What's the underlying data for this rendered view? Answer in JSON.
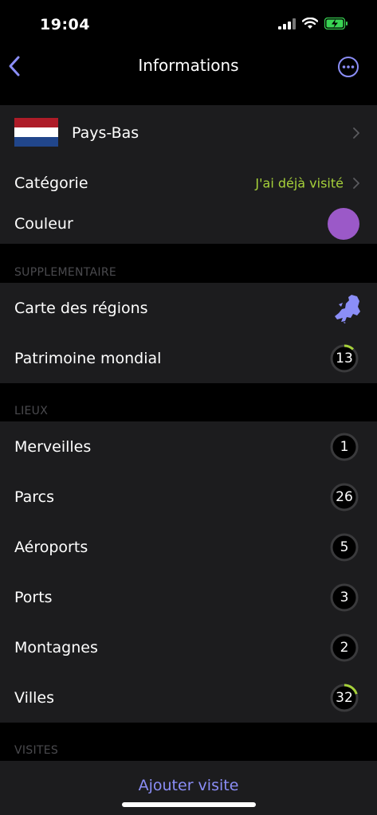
{
  "status": {
    "time": "19:04"
  },
  "nav": {
    "title": "Informations"
  },
  "country": {
    "name": "Pays-Bas"
  },
  "main": {
    "category_label": "Catégorie",
    "category_value": "J'ai déjà visité",
    "color_label": "Couleur",
    "color_value": "#9b59c8"
  },
  "supplementaire": {
    "header": "SUPPLEMENTAIRE",
    "regions_label": "Carte des régions",
    "heritage_label": "Patrimoine mondial",
    "heritage_count": "13",
    "heritage_progress": 0.12
  },
  "lieux": {
    "header": "LIEUX",
    "items": [
      {
        "label": "Merveilles",
        "count": "1",
        "progress": 0
      },
      {
        "label": "Parcs",
        "count": "26",
        "progress": 0
      },
      {
        "label": "Aéroports",
        "count": "5",
        "progress": 0
      },
      {
        "label": "Ports",
        "count": "3",
        "progress": 0
      },
      {
        "label": "Montagnes",
        "count": "2",
        "progress": 0
      },
      {
        "label": "Villes",
        "count": "32",
        "progress": 0.2
      }
    ]
  },
  "visites": {
    "header": "VISITES"
  },
  "bottom": {
    "add_visit": "Ajouter visite"
  },
  "colors": {
    "accent": "#8b8ef7",
    "progress": "#a6d13a",
    "group_bg": "#1c1c1e",
    "flag_red": "#ae1c28",
    "flag_white": "#ffffff",
    "flag_blue": "#21468b"
  }
}
